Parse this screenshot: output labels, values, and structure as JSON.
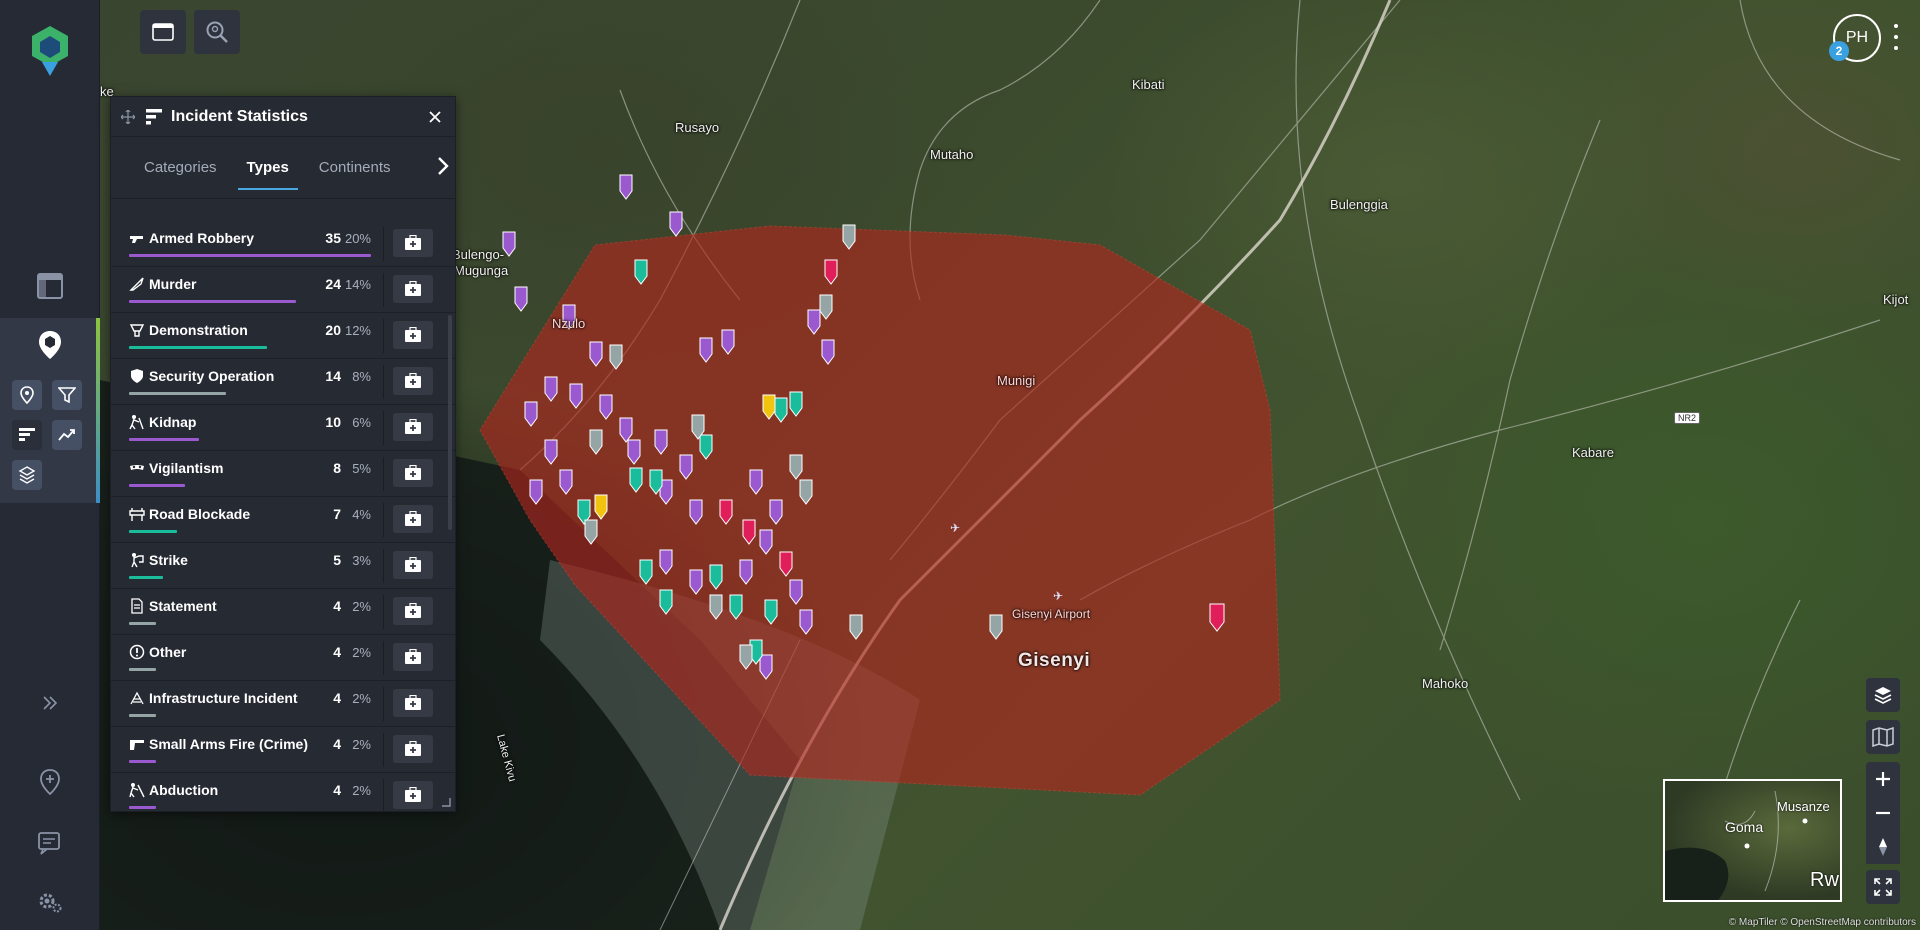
{
  "panel": {
    "title": "Incident Statistics",
    "tabs": [
      {
        "label": "Categories",
        "active": false
      },
      {
        "label": "Types",
        "active": true
      },
      {
        "label": "Continents",
        "active": false
      }
    ],
    "rows": [
      {
        "name": "Armed Robbery",
        "count": "35",
        "pct": "20%",
        "fraction": 1.0,
        "color": "#9b59d0",
        "icon": "gun-icon"
      },
      {
        "name": "Murder",
        "count": "24",
        "pct": "14%",
        "fraction": 0.69,
        "color": "#9b59d0",
        "icon": "knife-icon"
      },
      {
        "name": "Demonstration",
        "count": "20",
        "pct": "12%",
        "fraction": 0.57,
        "color": "#1abc9c",
        "icon": "megaphone-icon"
      },
      {
        "name": "Security Operation",
        "count": "14",
        "pct": "8%",
        "fraction": 0.4,
        "color": "#95a5a6",
        "icon": "shield-icon"
      },
      {
        "name": "Kidnap",
        "count": "10",
        "pct": "6%",
        "fraction": 0.29,
        "color": "#9b59d0",
        "icon": "kidnap-icon"
      },
      {
        "name": "Vigilantism",
        "count": "8",
        "pct": "5%",
        "fraction": 0.23,
        "color": "#9b59d0",
        "icon": "mask-icon"
      },
      {
        "name": "Road Blockade",
        "count": "7",
        "pct": "4%",
        "fraction": 0.2,
        "color": "#1abc9c",
        "icon": "barrier-icon"
      },
      {
        "name": "Strike",
        "count": "5",
        "pct": "3%",
        "fraction": 0.14,
        "color": "#1abc9c",
        "icon": "strike-icon"
      },
      {
        "name": "Statement",
        "count": "4",
        "pct": "2%",
        "fraction": 0.11,
        "color": "#95a5a6",
        "icon": "document-icon"
      },
      {
        "name": "Other",
        "count": "4",
        "pct": "2%",
        "fraction": 0.11,
        "color": "#95a5a6",
        "icon": "exclamation-icon"
      },
      {
        "name": "Infrastructure Incident",
        "count": "4",
        "pct": "2%",
        "fraction": 0.11,
        "color": "#95a5a6",
        "icon": "infrastructure-icon"
      },
      {
        "name": "Small Arms Fire (Crime)",
        "count": "4",
        "pct": "2%",
        "fraction": 0.11,
        "color": "#9b59d0",
        "icon": "pistol-icon"
      },
      {
        "name": "Abduction",
        "count": "4",
        "pct": "2%",
        "fraction": 0.11,
        "color": "#9b59d0",
        "icon": "abduction-icon"
      }
    ]
  },
  "map": {
    "places": [
      "Kibati",
      "Rusayo",
      "Mutaho",
      "Bulengo-",
      "Mugunga",
      "Nzulo",
      "Bulenggia",
      "Kijot",
      "Munigi",
      "Kabare",
      "Mahoko",
      "Gisenyi",
      "Gisenyi Airport",
      "Lake Kivu",
      "ke",
      "NR2"
    ],
    "region_color": "#b3261e"
  },
  "user": {
    "initials": "PH",
    "notifications": "2"
  },
  "minimap": {
    "labels": [
      "Musanze",
      "Goma",
      "Rw"
    ]
  },
  "attribution": "© MapTiler © OpenStreetMap contributors"
}
